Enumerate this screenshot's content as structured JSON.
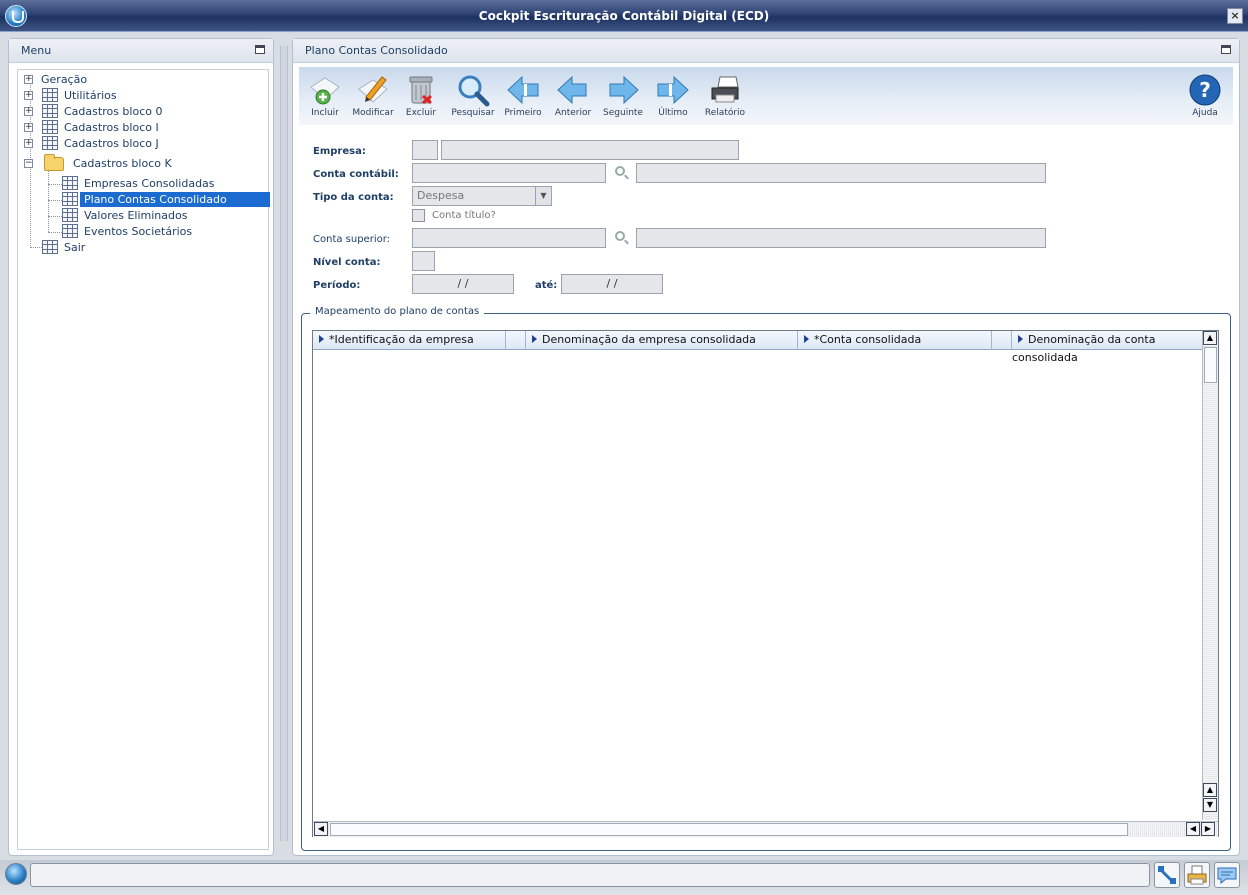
{
  "window": {
    "title": "Cockpit Escrituração Contábil Digital (ECD)",
    "close": "×"
  },
  "menu": {
    "title": "Menu",
    "items": [
      {
        "label": "Geração"
      },
      {
        "label": "Utilitários"
      },
      {
        "label": "Cadastros bloco 0"
      },
      {
        "label": "Cadastros bloco I"
      },
      {
        "label": "Cadastros bloco J"
      },
      {
        "label": "Cadastros bloco K"
      },
      {
        "label": "Empresas Consolidadas"
      },
      {
        "label": "Plano Contas Consolidado"
      },
      {
        "label": "Valores Eliminados"
      },
      {
        "label": "Eventos Societários"
      },
      {
        "label": "Sair"
      }
    ],
    "selected": "Plano Contas Consolidado"
  },
  "main": {
    "title": "Plano Contas Consolidado",
    "toolbar": {
      "incluir": "Incluir",
      "modificar": "Modificar",
      "excluir": "Excluir",
      "pesquisar": "Pesquisar",
      "primeiro": "Primeiro",
      "anterior": "Anterior",
      "seguinte": "Seguinte",
      "ultimo": "Último",
      "relatorio": "Relatório",
      "ajuda": "Ajuda"
    },
    "form": {
      "empresa_label": "Empresa:",
      "conta_contabil_label": "Conta contábil:",
      "tipo_conta_label": "Tipo da conta:",
      "tipo_conta_value": "Despesa",
      "conta_titulo_label": "Conta título?",
      "conta_superior_label": "Conta superior:",
      "nivel_conta_label": "Nível conta:",
      "periodo_label": "Período:",
      "periodo_from": "/ /",
      "ate_label": "até:",
      "periodo_to": "/ /"
    },
    "group": {
      "title": "Mapeamento do plano de contas",
      "columns": [
        "*Identificação da empresa",
        "Denominação da empresa consolidada",
        "*Conta consolidada",
        "Denominação da conta consolidada"
      ]
    }
  },
  "colors": {
    "accent": "#1c6bd0",
    "titlebar": "#2e4372"
  }
}
